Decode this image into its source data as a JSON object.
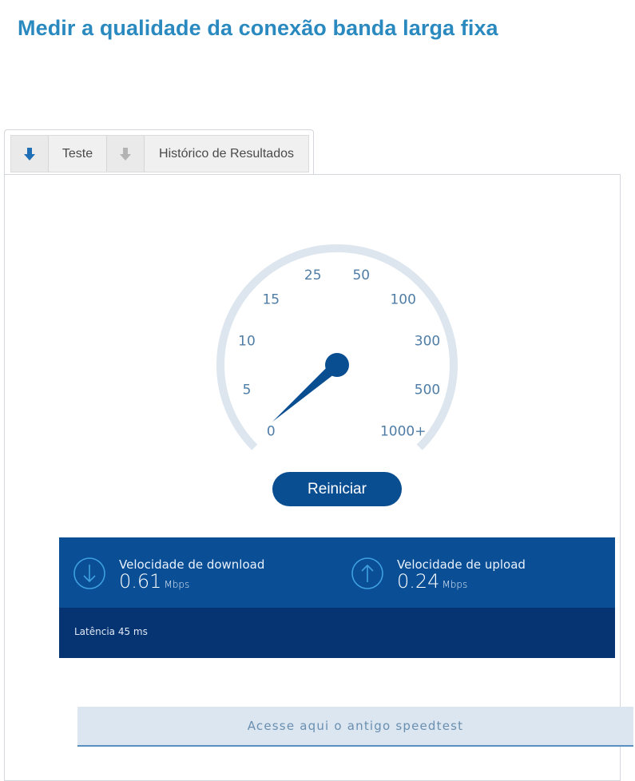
{
  "page": {
    "title": "Medir a qualidade da conexão banda larga fixa"
  },
  "tabs": [
    {
      "label": "Teste",
      "icon": "arrow-down-icon",
      "active": true
    },
    {
      "label": "Histórico de Resultados",
      "icon": "arrow-down-icon",
      "active": false
    }
  ],
  "gauge": {
    "scale_labels": [
      "0",
      "5",
      "10",
      "15",
      "25",
      "50",
      "100",
      "300",
      "500",
      "1000+"
    ],
    "needle_value": 0.61,
    "colors": {
      "track": "#dde6ee",
      "needle": "#0a4e92",
      "labels": "#4f7da6"
    }
  },
  "actions": {
    "restart_label": "Reiniciar"
  },
  "results": {
    "download": {
      "label": "Velocidade de download",
      "value": "0.61",
      "unit": "Mbps",
      "icon": "download-arrow-icon"
    },
    "upload": {
      "label": "Velocidade de upload",
      "value": "0.24",
      "unit": "Mbps",
      "icon": "upload-arrow-icon"
    },
    "latency": "Latência 45 ms",
    "colors": {
      "top": "#0a4f96",
      "bottom": "#063371"
    }
  },
  "footer": {
    "old_speedtest_label": "Acesse aqui o antigo speedtest"
  }
}
